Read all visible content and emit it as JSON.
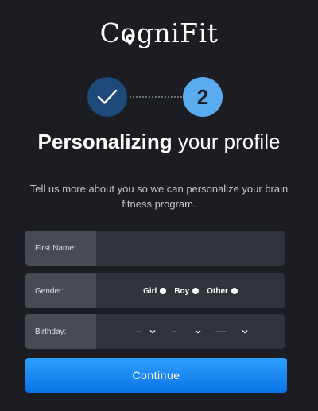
{
  "brand": {
    "logo_text": "CogniFit"
  },
  "progress": {
    "step1_state": "completed",
    "step2_number": "2",
    "current_step": 2,
    "total_steps": 2
  },
  "heading": {
    "bold": "Personalizing",
    "rest": " your profile"
  },
  "subtitle": "Tell us more about you so we can personalize your brain fitness program.",
  "form": {
    "first_name": {
      "label": "First Name:",
      "value": "",
      "placeholder": ""
    },
    "gender": {
      "label": "Gender:",
      "options": [
        "Girl",
        "Boy",
        "Other"
      ]
    },
    "birthday": {
      "label": "Birthday:",
      "day": "--",
      "month": "--",
      "year": "----"
    }
  },
  "continue_label": "Continue",
  "colors": {
    "background": "#1c1c23",
    "step_done": "#1e4a7a",
    "step_current": "#5aacf0",
    "button": "#1a8bf5"
  }
}
